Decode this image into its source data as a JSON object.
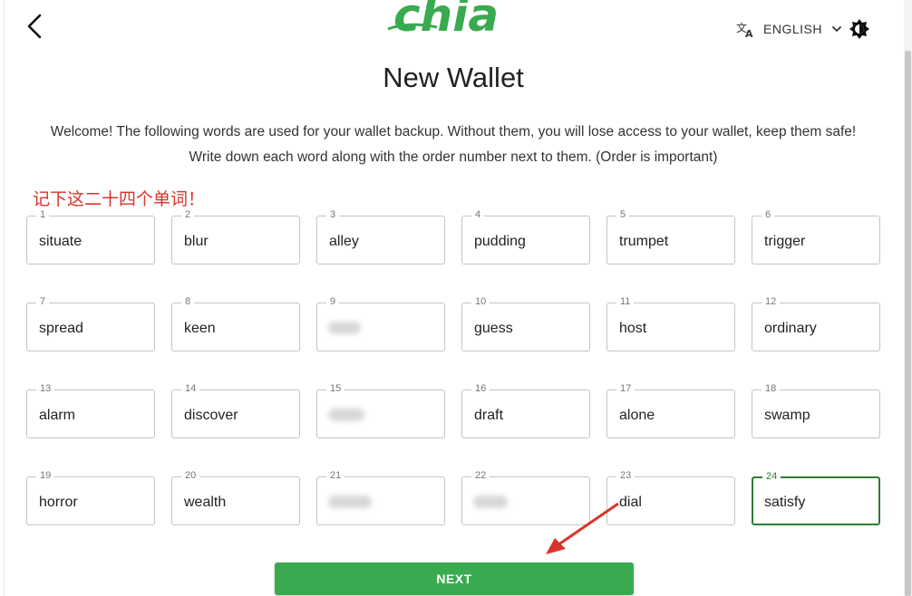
{
  "header": {
    "logo_text": "chia",
    "language": "ENGLISH"
  },
  "page": {
    "title": "New Wallet",
    "description_line1": "Welcome! The following words are used for your wallet backup. Without them, you will lose access to your wallet, keep them safe!",
    "description_line2": "Write down each word along with the order number next to them. (Order is important)",
    "annotation": "记下这二十四个单词！"
  },
  "words": [
    {
      "n": "1",
      "w": "situate"
    },
    {
      "n": "2",
      "w": "blur"
    },
    {
      "n": "3",
      "w": "alley"
    },
    {
      "n": "4",
      "w": "pudding"
    },
    {
      "n": "5",
      "w": "trumpet"
    },
    {
      "n": "6",
      "w": "trigger"
    },
    {
      "n": "7",
      "w": "spread"
    },
    {
      "n": "8",
      "w": "keen"
    },
    {
      "n": "9",
      "w": ""
    },
    {
      "n": "10",
      "w": "guess"
    },
    {
      "n": "11",
      "w": "host"
    },
    {
      "n": "12",
      "w": "ordinary"
    },
    {
      "n": "13",
      "w": "alarm"
    },
    {
      "n": "14",
      "w": "discover"
    },
    {
      "n": "15",
      "w": ""
    },
    {
      "n": "16",
      "w": "draft"
    },
    {
      "n": "17",
      "w": "alone"
    },
    {
      "n": "18",
      "w": "swamp"
    },
    {
      "n": "19",
      "w": "horror"
    },
    {
      "n": "20",
      "w": "wealth"
    },
    {
      "n": "21",
      "w": ""
    },
    {
      "n": "22",
      "w": ""
    },
    {
      "n": "23",
      "w": "dial"
    },
    {
      "n": "24",
      "w": "satisfy"
    }
  ],
  "active_word": "24",
  "redacted_words": [
    "9",
    "15",
    "21",
    "22"
  ],
  "actions": {
    "next_label": "NEXT"
  },
  "colors": {
    "brand_green": "#3aaa50",
    "active_border": "#2e7d32",
    "annotation_red": "#d9342b"
  }
}
